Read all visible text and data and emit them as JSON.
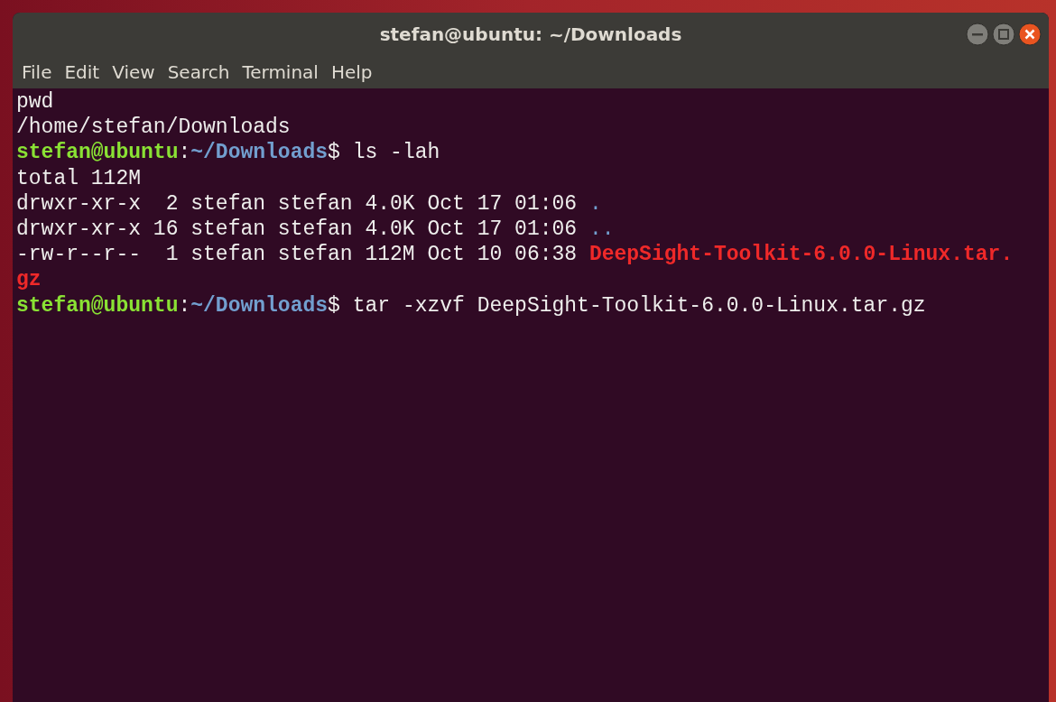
{
  "window": {
    "title": "stefan@ubuntu: ~/Downloads"
  },
  "menu": [
    "File",
    "Edit",
    "View",
    "Search",
    "Terminal",
    "Help"
  ],
  "terminal": {
    "lines": [
      [
        {
          "kind": "plain",
          "text": "pwd"
        }
      ],
      [
        {
          "kind": "plain",
          "text": "/home/stefan/Downloads"
        }
      ],
      [
        {
          "kind": "user",
          "text": "stefan@ubuntu"
        },
        {
          "kind": "plain",
          "text": ":"
        },
        {
          "kind": "path",
          "text": "~/Downloads"
        },
        {
          "kind": "plain",
          "text": "$ ls -lah"
        }
      ],
      [
        {
          "kind": "plain",
          "text": "total 112M"
        }
      ],
      [
        {
          "kind": "plain",
          "text": "drwxr-xr-x  2 stefan stefan 4.0K Oct 17 01:06 "
        },
        {
          "kind": "dir",
          "text": "."
        }
      ],
      [
        {
          "kind": "plain",
          "text": "drwxr-xr-x 16 stefan stefan 4.0K Oct 17 01:06 "
        },
        {
          "kind": "dir",
          "text": ".."
        }
      ],
      [
        {
          "kind": "plain",
          "text": "-rw-r--r--  1 stefan stefan 112M Oct 10 06:38 "
        },
        {
          "kind": "archive",
          "text": "DeepSight-Toolkit-6.0.0-Linux.tar."
        }
      ],
      [
        {
          "kind": "archive",
          "text": "gz"
        }
      ],
      [
        {
          "kind": "user",
          "text": "stefan@ubuntu"
        },
        {
          "kind": "plain",
          "text": ":"
        },
        {
          "kind": "path",
          "text": "~/Downloads"
        },
        {
          "kind": "plain",
          "text": "$ tar -xzvf DeepSight-Toolkit-6.0.0-Linux.tar.gz"
        }
      ]
    ]
  }
}
